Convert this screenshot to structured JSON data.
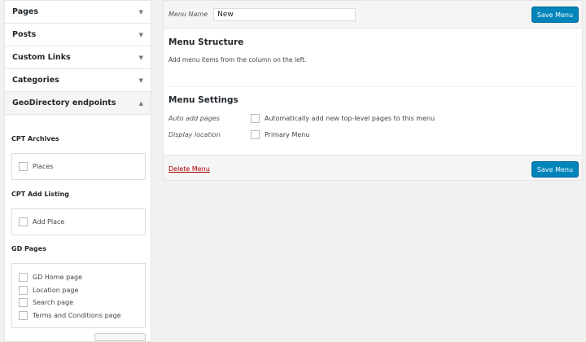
{
  "sidebar": {
    "accordions": [
      {
        "label": "Pages",
        "icon": "arrow-down-icon"
      },
      {
        "label": "Posts",
        "icon": "arrow-down-icon"
      },
      {
        "label": "Custom Links",
        "icon": "arrow-down-icon"
      },
      {
        "label": "Categories",
        "icon": "arrow-down-icon"
      },
      {
        "label": "GeoDirectory endpoints",
        "icon": "arrow-up-icon"
      }
    ],
    "sections": [
      {
        "title": "CPT Archives",
        "items": [
          "Places"
        ]
      },
      {
        "title": "CPT Add Listing",
        "items": [
          "Add Place"
        ]
      },
      {
        "title": "GD Pages",
        "items": [
          "GD Home page",
          "Location page",
          "Search page",
          "Terms and Conditions page"
        ]
      }
    ]
  },
  "menu": {
    "name_label": "Menu Name",
    "name_value": "New",
    "save_label": "Save Menu",
    "structure_title": "Menu Structure",
    "structure_desc": "Add menu items from the column on the left.",
    "settings_title": "Menu Settings",
    "auto_add_label": "Auto add pages",
    "auto_add_option": "Automatically add new top-level pages to this menu",
    "display_label": "Display location",
    "display_option": "Primary Menu",
    "delete_label": "Delete Menu",
    "button_color": "#0085ba"
  }
}
